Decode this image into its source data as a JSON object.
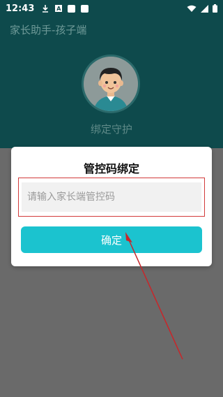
{
  "status_bar": {
    "time": "12:43"
  },
  "app": {
    "title": "家长助手-孩子端",
    "bind_label": "绑定守护"
  },
  "dialog": {
    "title": "管控码绑定",
    "input_placeholder": "请输入家长端管控码",
    "input_value": "",
    "confirm_label": "确定"
  },
  "colors": {
    "header_bg": "#0e4a4c",
    "button": "#1bc3cf",
    "highlight": "#d23a3a",
    "overlay": "#6a6a6a"
  },
  "icons": [
    "download-icon",
    "a-notification-icon",
    "wifi-icon",
    "signal-icon",
    "battery-icon",
    "avatar-boy-icon",
    "red-arrow-annotation"
  ]
}
